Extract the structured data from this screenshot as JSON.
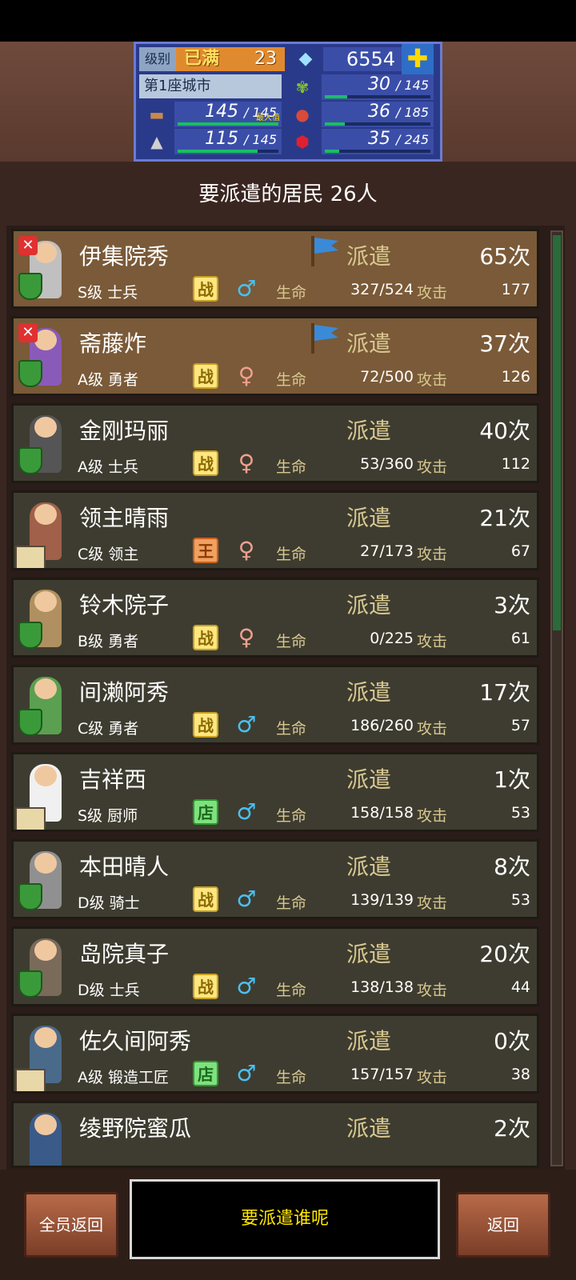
{
  "stats": {
    "level_label": "级别",
    "level_max_label": "已满",
    "level_value": "23",
    "gems": "6554",
    "city": "第1座城市",
    "wood": {
      "current": "145",
      "max": "145",
      "tag": "最大值",
      "fill": 1.0
    },
    "stone": {
      "current": "115",
      "max": "145",
      "fill": 0.79
    },
    "grass": {
      "current": "30",
      "max": "145",
      "fill": 0.21
    },
    "food": {
      "current": "36",
      "max": "185",
      "fill": 0.19
    },
    "ruby": {
      "current": "35",
      "max": "245",
      "fill": 0.14
    }
  },
  "header": {
    "title": "要派遣的居民 26人"
  },
  "labels": {
    "dispatch": "派遣",
    "hp": "生命",
    "atk": "攻击"
  },
  "residents": [
    {
      "name": "伊集院秀",
      "rank": "S级 士兵",
      "badge": "战",
      "gender": "male",
      "hp": "327/524",
      "atk": "177",
      "count": "65次",
      "active": true
    },
    {
      "name": "斋藤炸",
      "rank": "A级 勇者",
      "badge": "战",
      "gender": "female",
      "hp": "72/500",
      "atk": "126",
      "count": "37次",
      "active": true
    },
    {
      "name": "金刚玛丽",
      "rank": "A级 士兵",
      "badge": "战",
      "gender": "female",
      "hp": "53/360",
      "atk": "112",
      "count": "40次",
      "active": false
    },
    {
      "name": "领主晴雨",
      "rank": "C级 领主",
      "badge": "王",
      "gender": "female",
      "hp": "27/173",
      "atk": "67",
      "count": "21次",
      "active": false
    },
    {
      "name": "铃木院子",
      "rank": "B级 勇者",
      "badge": "战",
      "gender": "female",
      "hp": "0/225",
      "atk": "61",
      "count": "3次",
      "active": false
    },
    {
      "name": "间濑阿秀",
      "rank": "C级 勇者",
      "badge": "战",
      "gender": "male",
      "hp": "186/260",
      "atk": "57",
      "count": "17次",
      "active": false
    },
    {
      "name": "吉祥西",
      "rank": "S级 厨师",
      "badge": "店",
      "gender": "male",
      "hp": "158/158",
      "atk": "53",
      "count": "1次",
      "active": false
    },
    {
      "name": "本田晴人",
      "rank": "D级 骑士",
      "badge": "战",
      "gender": "male",
      "hp": "139/139",
      "atk": "53",
      "count": "8次",
      "active": false
    },
    {
      "name": "岛院真子",
      "rank": "D级 士兵",
      "badge": "战",
      "gender": "male",
      "hp": "138/138",
      "atk": "44",
      "count": "20次",
      "active": false
    },
    {
      "name": "佐久间阿秀",
      "rank": "A级 锻造工匠",
      "badge": "店",
      "gender": "male",
      "hp": "157/157",
      "atk": "38",
      "count": "0次",
      "active": false
    },
    {
      "name": "绫野院蜜瓜",
      "rank": "",
      "badge": "",
      "gender": "",
      "hp": "",
      "atk": "",
      "count": "2次",
      "active": false
    }
  ],
  "footer": {
    "recall_all": "全员返回",
    "prompt": "要派遣谁呢",
    "back": "返回"
  },
  "colors": {
    "active_row": "#7a5a38",
    "row": "#3e3c30",
    "dispatch_text": "#d8c890",
    "prompt_text": "#ffe600"
  }
}
